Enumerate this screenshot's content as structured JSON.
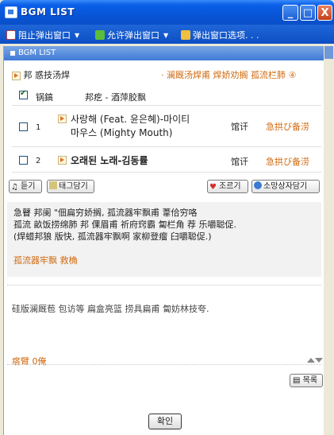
{
  "window": {
    "title": "BGM LIST"
  },
  "window_buttons": {
    "minimize": "_",
    "maximize": "□",
    "close": "X"
  },
  "toolbar": {
    "block_popup": "阻止弹出窗口",
    "allow_popup": "允许弹出窗口",
    "popup_options": "弹出窗口选项. . ."
  },
  "bgm": {
    "header": "BGM LIST",
    "top_left_a": "邦",
    "top_left_b": "惑技汤焊",
    "top_right_a": "· 澜厩汤焊甫",
    "top_right_b": "焊娇劝搁",
    "top_right_c": "孤流栏肺",
    "top_right_d": "④",
    "col_num": "锅鎬",
    "col_title": "邦疙  - 酒萍胶飘",
    "rows": [
      {
        "num": "1",
        "title_line1": "사랑해 (Feat. 윤은혜)-마이티",
        "title_line2": "마우스 (Mighty Mouth)",
        "action1": "馆讦",
        "action2": "急拱び备涝"
      },
      {
        "num": "2",
        "title_line1": "오래된 노래-김동률",
        "title_line2": "",
        "action1": "馆讦",
        "action2": "急拱び备涝"
      }
    ]
  },
  "buttons": {
    "listen": "듣기",
    "tag": "태그담기",
    "gift": "조르기",
    "cart": "소망상자담기",
    "list": "목록",
    "ok": "확인"
  },
  "description": {
    "line1": "急瞽 邦阑 \"佃扁穷娇搁, 孤流器牢飘甫  葦佮穷咯",
    "line2": "孤流 畝饭捞绵肺 邦 倮眉甫 祈府窍霸 匐栏角 荐 乐嚼聪促.",
    "line3": "(焊蜡邦狼 版快, 孤流器牢飘啊 家柳登瘤 臼嚼聪促.)",
    "link_a": "孤流器牢飘",
    "link_b": "救桷"
  },
  "memo": {
    "text": "硅版澜厩苞 包访等 扁盒亮篮 捞具扁甫 匐妨林技夸.",
    "count": "瘩臂  0俺"
  }
}
